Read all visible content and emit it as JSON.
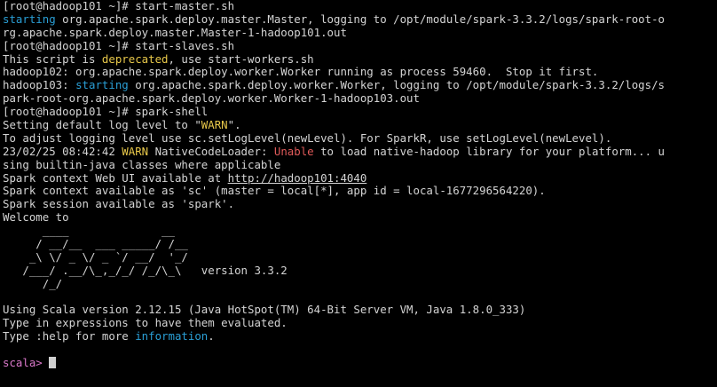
{
  "terminal": {
    "colors": {
      "background": "#000000",
      "text": "#d4d4d4",
      "info_blue": "#2a9fd6",
      "warn_yellow": "#e8c84a",
      "error_red": "#e05a5a",
      "scala_prompt": "#d977c9"
    },
    "lines": {
      "l1": "[root@hadoop101 ~]# start-master.sh",
      "l2a": "starting",
      "l2b": " org.apache.spark.deploy.master.Master, logging to /opt/module/spark-3.3.2/logs/spark-root-o",
      "l3": "rg.apache.spark.deploy.master.Master-1-hadoop101.out",
      "l4": "[root@hadoop101 ~]# start-slaves.sh",
      "l5a": "This script is ",
      "l5b": "deprecated",
      "l5c": ", use start-workers.sh",
      "l6": "hadoop102: org.apache.spark.deploy.worker.Worker running as process 59460.  Stop it first.",
      "l7a": "hadoop103: ",
      "l7b": "starting",
      "l7c": " org.apache.spark.deploy.worker.Worker, logging to /opt/module/spark-3.3.2/logs/s",
      "l8": "park-root-org.apache.spark.deploy.worker.Worker-1-hadoop103.out",
      "l9": "[root@hadoop101 ~]# spark-shell",
      "l10a": "Setting default log level to \"",
      "l10b": "WARN",
      "l10c": "\".",
      "l11": "To adjust logging level use sc.setLogLevel(newLevel). For SparkR, use setLogLevel(newLevel).",
      "l12a": "23/02/25 08:42:42 ",
      "l12b": "WARN",
      "l12c": " NativeCodeLoader: ",
      "l12d": "Unable",
      "l12e": " to load native-hadoop library for your platform... u",
      "l13": "sing builtin-java classes where applicable",
      "l14a": "Spark context Web UI available at ",
      "l14b": "http://hadoop101:4040",
      "l15": "Spark context available as 'sc' (master = local[*], app id = local-1677296564220).",
      "l16": "Spark session available as 'spark'.",
      "l17": "Welcome to",
      "banner1": "      ____              __",
      "banner2": "     / __/__  ___ _____/ /__",
      "banner3": "    _\\ \\/ _ \\/ _ `/ __/  '_/",
      "banner4": "   /___/ .__/\\_,_/_/ /_/\\_\\   version 3.3.2",
      "banner5": "      /_/",
      "l23": "Using Scala version 2.12.15 (Java HotSpot(TM) 64-Bit Server VM, Java 1.8.0_333)",
      "l24": "Type in expressions to have them evaluated.",
      "l25a": "Type :help for more ",
      "l25b": "information",
      "l25c": ".",
      "prompt": "scala> "
    }
  }
}
